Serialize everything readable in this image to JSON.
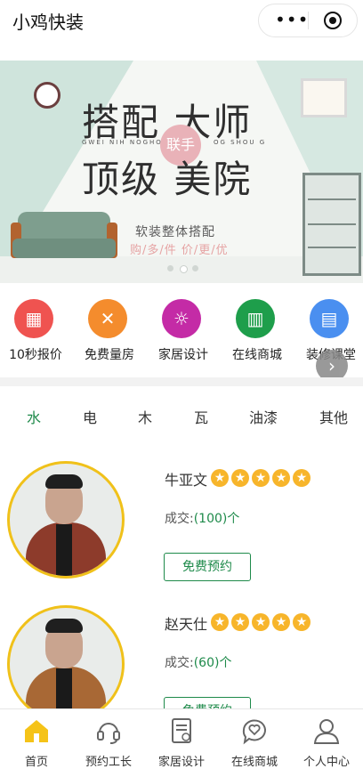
{
  "header": {
    "title": "小鸡快装",
    "more": "•••"
  },
  "banner": {
    "line1": "搭配 大师",
    "line2": "顶级 美院",
    "badge": "联手",
    "tiny_left": "GWEI NIH  NOGHOR QOH",
    "tiny_right": "OG SHOU G",
    "subtitle": "软装整体搭配",
    "slogan": "购/多/件 价/更/优",
    "slide_count": 3,
    "active_slide": 2
  },
  "quick_grid": {
    "items": [
      {
        "label": "10秒报价",
        "icon": "calculator-icon",
        "color": "#ef5350"
      },
      {
        "label": "免费量房",
        "icon": "tools-icon",
        "color": "#f48c2d"
      },
      {
        "label": "家居设计",
        "icon": "lightbulb-icon",
        "color": "#c42ba6"
      },
      {
        "label": "在线商城",
        "icon": "building-icon",
        "color": "#1e9e4b"
      },
      {
        "label": "装修课堂",
        "icon": "book-icon",
        "color": "#4a8ff0"
      }
    ],
    "next_icon": "chevron-right-icon"
  },
  "trade_tabs": {
    "items": [
      "水",
      "电",
      "木",
      "瓦",
      "油漆",
      "其他"
    ],
    "active": "水"
  },
  "workers": [
    {
      "name": "牛亚文",
      "rating": 5,
      "deals_label": "成交:",
      "deals_value": "(100)个",
      "button": "免费预约"
    },
    {
      "name": "赵天仕",
      "rating": 5,
      "deals_label": "成交:",
      "deals_value": "(60)个",
      "button": "免费预约"
    }
  ],
  "tabbar": {
    "items": [
      {
        "label": "首页",
        "icon": "home-icon",
        "active": true
      },
      {
        "label": "预约工长",
        "icon": "headset-icon"
      },
      {
        "label": "家居设计",
        "icon": "document-icon"
      },
      {
        "label": "在线商城",
        "icon": "chat-heart-icon"
      },
      {
        "label": "个人中心",
        "icon": "user-icon"
      }
    ]
  },
  "colors": {
    "accent": "#1e8a4a",
    "star": "#f7b52b",
    "avatar_ring": "#f0c11a",
    "home_active": "#f5c318"
  }
}
